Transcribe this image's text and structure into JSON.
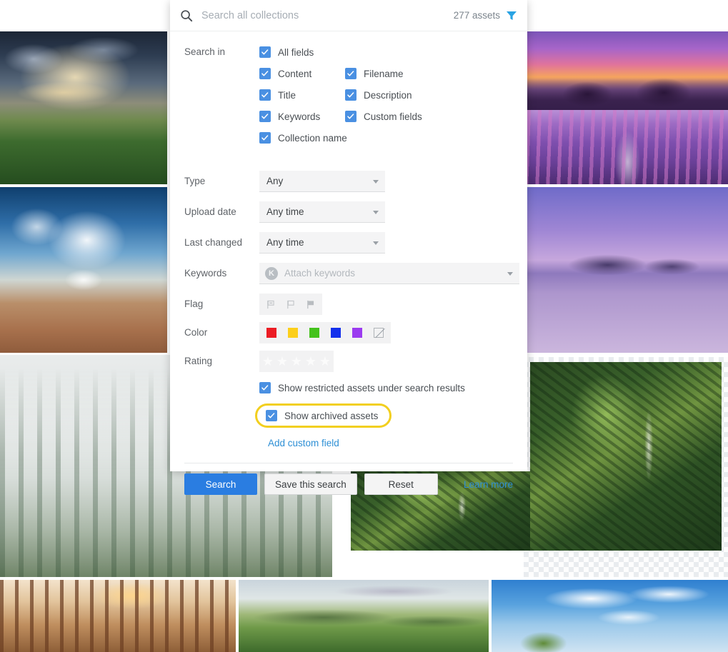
{
  "search_bar": {
    "icon": "search-icon",
    "placeholder": "Search all collections",
    "value": "",
    "asset_count": "277 assets",
    "filter_icon": "funnel-icon",
    "filter_icon_color": "#29a3e3"
  },
  "search_in": {
    "label": "Search in",
    "options": [
      {
        "label": "All fields",
        "checked": true
      },
      {
        "label": "Content",
        "checked": true
      },
      {
        "label": "Filename",
        "checked": true
      },
      {
        "label": "Title",
        "checked": true
      },
      {
        "label": "Description",
        "checked": true
      },
      {
        "label": "Keywords",
        "checked": true
      },
      {
        "label": "Custom fields",
        "checked": true
      },
      {
        "label": "Collection name",
        "checked": true
      }
    ]
  },
  "filters": {
    "type": {
      "label": "Type",
      "value": "Any"
    },
    "upload_date": {
      "label": "Upload date",
      "value": "Any time"
    },
    "last_changed": {
      "label": "Last changed",
      "value": "Any time"
    },
    "keywords": {
      "label": "Keywords",
      "placeholder": "Attach keywords",
      "chip": "K"
    },
    "flag": {
      "label": "Flag",
      "items": [
        {
          "name": "flag-rejected-icon"
        },
        {
          "name": "flag-unflagged-icon"
        },
        {
          "name": "flag-flagged-icon"
        }
      ]
    },
    "color": {
      "label": "Color",
      "swatches": [
        "#ec1c24",
        "#fccf1b",
        "#44c21c",
        "#1430ec",
        "#9b3bf0"
      ],
      "none_label": "no-color"
    },
    "rating": {
      "label": "Rating",
      "stars": 5,
      "value": 0,
      "star_color": "#fbfbfb"
    }
  },
  "toggles": {
    "show_restricted": {
      "label": "Show restricted assets under search results",
      "checked": true
    },
    "show_archived": {
      "label": "Show archived assets",
      "checked": true,
      "highlighted": true,
      "highlight_color": "#f2cf1f"
    }
  },
  "add_custom_field": {
    "label": "Add custom field"
  },
  "actions": {
    "search": "Search",
    "save_this_search": "Save this search",
    "reset": "Reset",
    "learn_more": "Learn more",
    "primary_color": "#2a7de1",
    "link_color": "#2d8fd5"
  },
  "background_assets": [
    {
      "name": "storm-clouds-over-green-valley"
    },
    {
      "name": "desert-dunes-with-cloud-and-snow-peak"
    },
    {
      "name": "foggy-pine-forest"
    },
    {
      "name": "autumn-sunlit-pine-trunks"
    },
    {
      "name": "purple-orange-volcano-sunset"
    },
    {
      "name": "lavender-field-path"
    },
    {
      "name": "purple-lake-and-mountain"
    },
    {
      "name": "aerial-forest-meadow-road"
    },
    {
      "name": "rolling-green-hills"
    },
    {
      "name": "blue-sky-with-clouds-and-bush"
    }
  ]
}
